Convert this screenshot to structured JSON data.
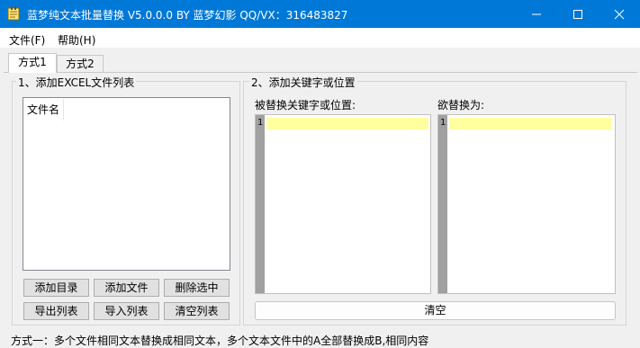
{
  "window": {
    "title": "蓝梦纯文本批量替换 V5.0.0.0 BY 蓝梦幻影 QQ/VX：316483827",
    "icon": "notepad-icon"
  },
  "menu": {
    "file": "文件(F)",
    "help": "帮助(H)"
  },
  "tabs": [
    {
      "label": "方式1",
      "active": true
    },
    {
      "label": "方式2",
      "active": false
    }
  ],
  "left_group": {
    "title": "1、添加EXCEL文件列表",
    "column_header": "文件名",
    "buttons": {
      "add_dir": "添加目录",
      "add_file": "添加文件",
      "delete_selected": "删除选中",
      "export_list": "导出列表",
      "import_list": "导入列表",
      "clear_list": "清空列表"
    }
  },
  "right_group": {
    "title": "2、添加关键字或位置",
    "find_label": "被替换关键字或位置:",
    "replace_label": "欲替换为:",
    "find_line": "1",
    "replace_line": "1",
    "clear_button": "清空"
  },
  "status_text": "方式一：多个文件相同文本替换成相同文本，多个文本文件中的A全部替换成B,相同内容",
  "colors": {
    "titlebar": "#0078d7",
    "current_line": "#ffffa0",
    "gutter": "#a0a0a0"
  }
}
